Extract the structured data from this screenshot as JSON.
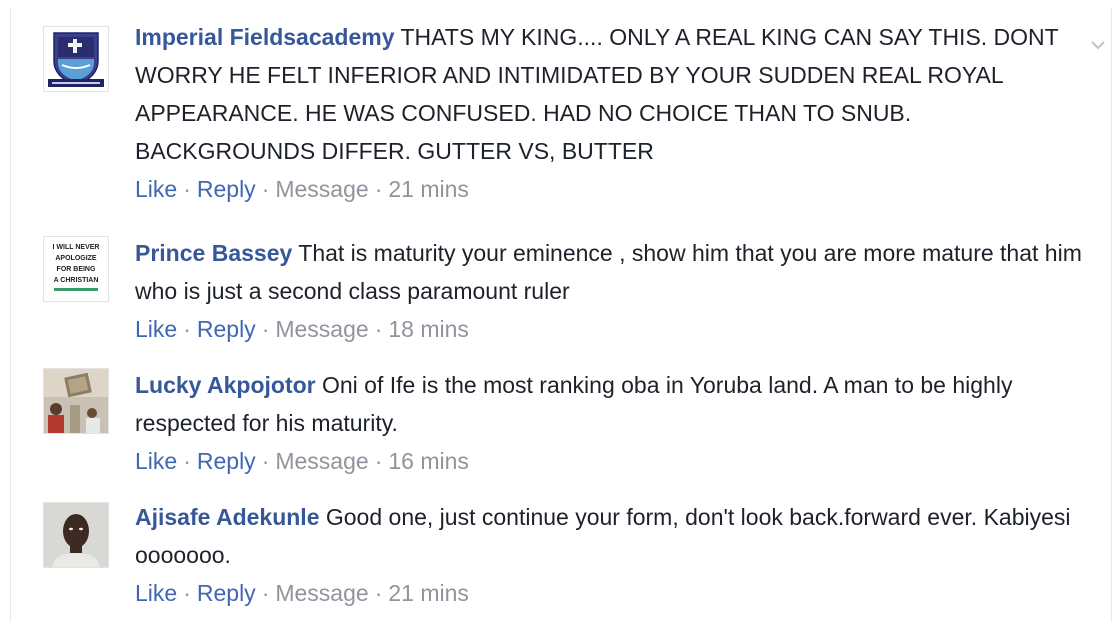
{
  "comments": [
    {
      "author": "Imperial Fieldsacademy",
      "text": "THATS MY KING.... ONLY A REAL KING CAN SAY THIS. DONT WORRY HE FELT INFERIOR AND INTIMIDATED BY YOUR SUDDEN REAL ROYAL APPEARANCE. HE WAS CONFUSED. HAD NO CHOICE THAN TO SNUB. BACKGROUNDS DIFFER. GUTTER VS, BUTTER",
      "like": "Like",
      "reply": "Reply",
      "message": "Message",
      "time": "21 mins",
      "avatar_icon": "school-crest-icon"
    },
    {
      "author": "Prince Bassey",
      "text": "That is maturity your eminence , show him that you are more mature that him who is just a second class paramount ruler",
      "like": "Like",
      "reply": "Reply",
      "message": "Message",
      "time": "18 mins",
      "avatar_icon": "text-poster-icon",
      "avatar_text": [
        "I WILL NEVER",
        "APOLOGIZE",
        "FOR BEING",
        "A CHRISTIAN"
      ]
    },
    {
      "author": "Lucky Akpojotor",
      "text": "Oni of Ife is the most ranking oba in Yoruba land. A man to be highly respected for his maturity.",
      "like": "Like",
      "reply": "Reply",
      "message": "Message",
      "time": "16 mins",
      "avatar_icon": "room-photo-icon"
    },
    {
      "author": "Ajisafe Adekunle",
      "text": "Good one, just continue your form, don't look back.forward ever. Kabiyesi ooooooo.",
      "like": "Like",
      "reply": "Reply",
      "message": "Message",
      "time": "21 mins",
      "avatar_icon": "person-photo-icon"
    }
  ],
  "separator": "·",
  "colors": {
    "author": "#365899",
    "action_link": "#4267b2",
    "meta": "#90949c",
    "text": "#1d2129"
  }
}
